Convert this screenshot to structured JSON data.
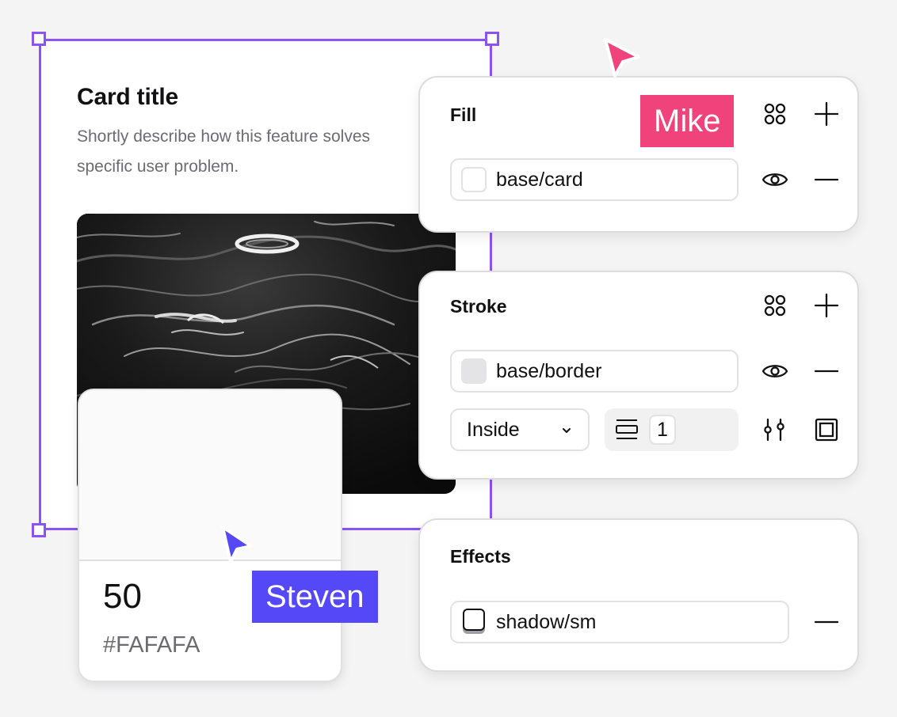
{
  "card": {
    "title": "Card title",
    "description_line1": "Shortly describe how this feature solves",
    "description_line2": "specific user problem."
  },
  "swatch": {
    "number": "50",
    "hex": "#FAFAFA",
    "color": "#FAFAFA"
  },
  "fill_panel": {
    "title": "Fill",
    "token_label": "base/card"
  },
  "stroke_panel": {
    "title": "Stroke",
    "token_label": "base/border",
    "position_value": "Inside",
    "weight_value": "1"
  },
  "effects_panel": {
    "title": "Effects",
    "token_label": "shadow/sm"
  },
  "collaborators": {
    "mike": {
      "name": "Mike",
      "color": "#f1437b"
    },
    "steven": {
      "name": "Steven",
      "color": "#5548f6"
    }
  },
  "colors": {
    "selection": "#8b52f5",
    "background": "#f4f4f5"
  }
}
